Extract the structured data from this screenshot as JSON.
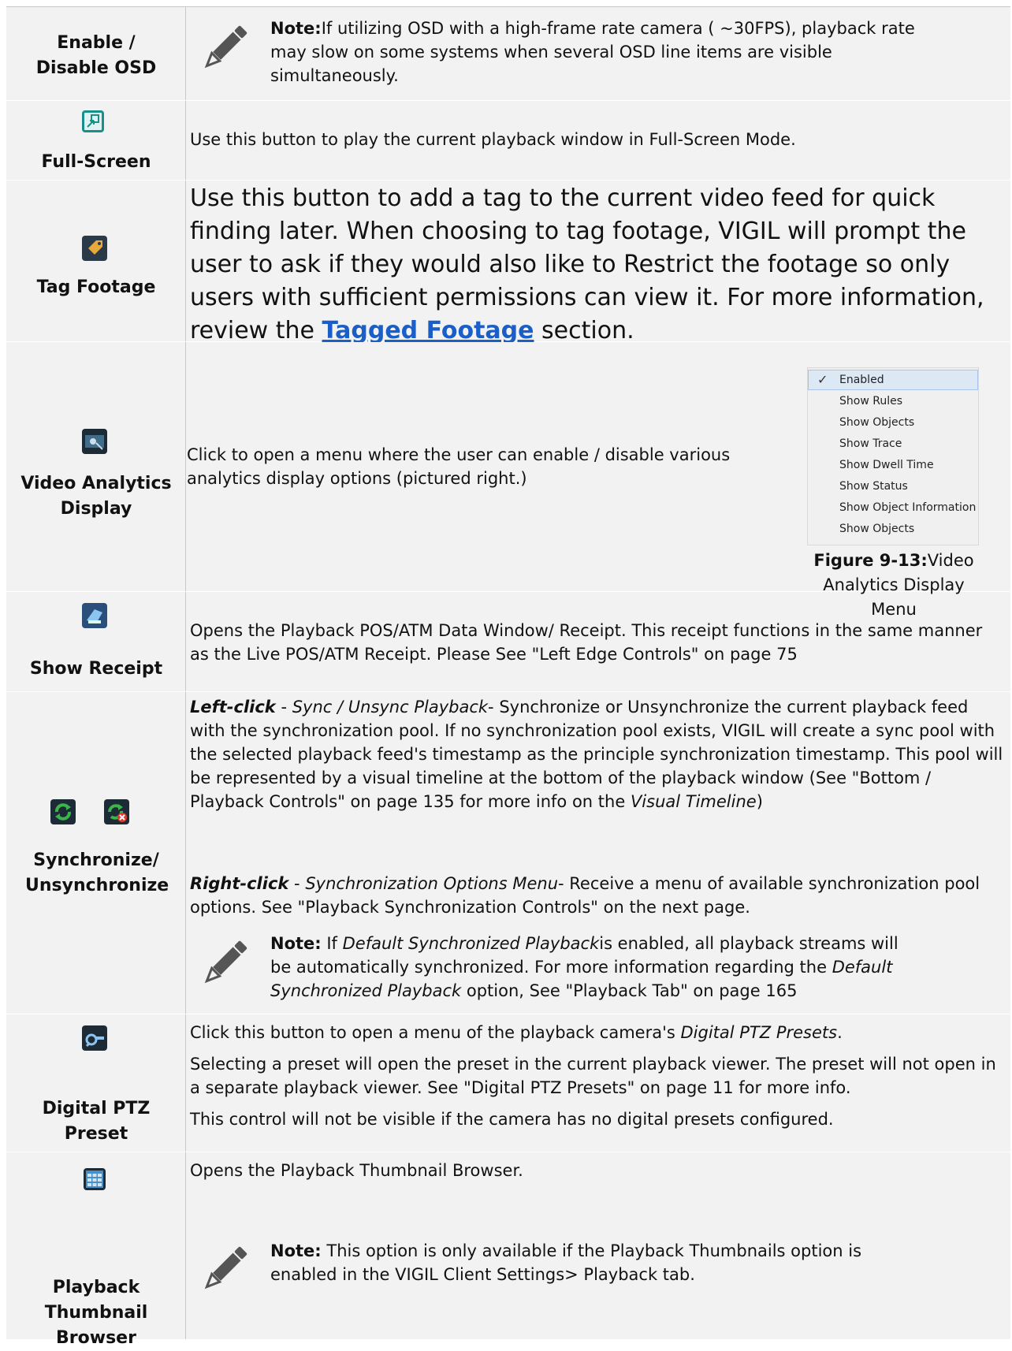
{
  "rows": {
    "osd": {
      "label": "Enable / Disable OSD",
      "note_label": "Note:",
      "note_text": "If utilizing OSD with a high-frame rate camera ( ~30FPS), playback rate may slow on some systems when several OSD line items are visible simultaneously."
    },
    "fullscreen": {
      "label": "Full-Screen",
      "text": "Use this button to play the current playback window in Full-Screen Mode."
    },
    "tag": {
      "label": "Tag Footage",
      "text_before": "Use this button to add a tag to the current video feed for quick finding later. When choosing to tag footage, VIGIL will prompt the user to ask if they would also like to Restrict the footage so only users with sufficient permissions can view it. For more information, review the ",
      "link": "Tagged Footage",
      "text_after": " section."
    },
    "analytics": {
      "label": "Video Analytics Display",
      "text": "Click to open a menu where the user can enable / disable various analytics display options (pictured right.)",
      "menu_items": [
        "Enabled",
        "Show Rules",
        "Show Objects",
        "Show Trace",
        "Show Dwell Time",
        "Show Status",
        "Show Object Information",
        "Show Objects"
      ],
      "check": "✓",
      "figure_label": "Figure 9-13:",
      "figure_caption": "Video Analytics Display Menu"
    },
    "receipt": {
      "label": "Show Receipt",
      "text": "Opens the Playback POS/ATM Data Window/ Receipt. This receipt functions in the same manner as the Live POS/ATM Receipt. Please See \"Left Edge Controls\" on page 75"
    },
    "sync": {
      "label": "Synchronize/ Unsynchronize",
      "left_head": "Left-click",
      "left_sub": "Sync / Unsync Playback",
      "left_text": "Synchronize or Unsynchronize the current playback feed with the synchronization pool. If no synchronization pool exists, VIGIL will create a sync pool with the selected playback feed's timestamp as the principle synchronization timestamp. This pool will be represented by a visual timeline at the bottom of the playback window (See \"Bottom / Playback Controls\" on page 135 for more info on the ",
      "left_italic": "Visual Timeline",
      "left_end": ")",
      "right_head": "Right-click",
      "right_sub": "Synchronization Options Menu",
      "right_text": "Receive a menu of available synchronization pool options. See \"Playback Synchronization Controls\" on the next page.",
      "note_label": "Note:",
      "note_a": " If ",
      "note_italic1": "Default Synchronized Playback",
      "note_b": "is enabled, all playback streams will be automatically synchronized. For more information regarding the ",
      "note_italic2": "Default Synchronized Playback",
      "note_c": " option, See \"Playback Tab\" on page 165"
    },
    "ptz": {
      "label": "Digital PTZ Preset",
      "p1_a": "Click this button to open a menu of the playback camera's ",
      "p1_italic": "Digital PTZ Presets",
      "p1_b": ".",
      "p2": "Selecting a preset will open the preset in the current playback viewer. The preset will not open in a separate playback viewer. See \"Digital PTZ Presets\" on page 11 for more info.",
      "p3": "This control will not be visible if the camera has no digital presets configured."
    },
    "thumb": {
      "label": "Playback Thumbnail Browser",
      "text": "Opens the Playback Thumbnail Browser.",
      "note_label": "Note:",
      "note_text": " This option is only available if the Playback Thumbnails option is enabled in the VIGIL Client Settings> Playback tab."
    }
  },
  "icons": {
    "osd_note": "pencil-icon",
    "fullscreen": "fullscreen-icon",
    "tag": "tag-icon",
    "analytics": "analytics-icon",
    "receipt": "receipt-icon",
    "sync": "sync-icon",
    "unsync": "unsync-icon",
    "ptz": "ptz-preset-icon",
    "thumb": "thumbnail-grid-icon"
  },
  "colors": {
    "row_bg": "#f2f2f2",
    "link": "#1a5fc8",
    "icon_bg": "#1d2b36",
    "sync_green": "#3bb54a",
    "unsync_red": "#e03a2f"
  }
}
